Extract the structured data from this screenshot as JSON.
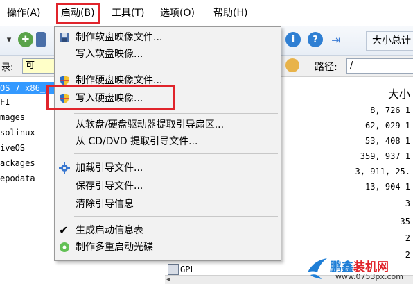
{
  "menubar": {
    "items": [
      {
        "label": "操作(A)"
      },
      {
        "label": "启动(B)"
      },
      {
        "label": "工具(T)"
      },
      {
        "label": "选项(O)"
      },
      {
        "label": "帮助(H)"
      }
    ]
  },
  "toolbar": {
    "size_button_label": "大小总计",
    "colors": {
      "info": "#2f7fd3",
      "help": "#2f7fd3",
      "exit": "#3a7bd5"
    }
  },
  "address": {
    "left_label": "录:",
    "left_value": "可",
    "path_label": "路径:",
    "path_value": "/"
  },
  "tree": {
    "items": [
      {
        "label": "OS 7 x86_"
      },
      {
        "label": "FI"
      },
      {
        "label": "mages"
      },
      {
        "label": "solinux"
      },
      {
        "label": "iveOS"
      },
      {
        "label": "ackages"
      },
      {
        "label": "epodata"
      }
    ]
  },
  "filelist": {
    "column_header": "大小",
    "sizes": [
      "8, 726 1",
      "62, 029 1",
      "53, 408 1",
      "359, 937 1",
      "3, 911, 25.",
      "13, 904 1",
      "3",
      "35",
      "2",
      "2"
    ],
    "bottom_file": "GPL"
  },
  "dropdown": {
    "items": [
      {
        "label": "制作软盘映像文件...",
        "icon": "floppy-icon"
      },
      {
        "label": "写入软盘映像...",
        "icon": ""
      },
      {
        "label": "制作硬盘映像文件...",
        "icon": "shield-icon"
      },
      {
        "label": "写入硬盘映像...",
        "icon": "shield-icon"
      },
      {
        "label": "从软盘/硬盘驱动器提取引导扇区...",
        "icon": ""
      },
      {
        "label": "从 CD/DVD 提取引导文件...",
        "icon": ""
      },
      {
        "label": "加载引导文件...",
        "icon": "gear-icon"
      },
      {
        "label": "保存引导文件...",
        "icon": ""
      },
      {
        "label": "清除引导信息",
        "icon": ""
      },
      {
        "label": "生成启动信息表",
        "icon": "checkmark-icon"
      },
      {
        "label": "制作多重启动光碟",
        "icon": "green-disc-icon"
      }
    ]
  },
  "watermark": {
    "brand_main": "鹏鑫",
    "brand_accent": "装机网",
    "url": "www.0753px.com"
  },
  "accent_color": "#e0242b"
}
